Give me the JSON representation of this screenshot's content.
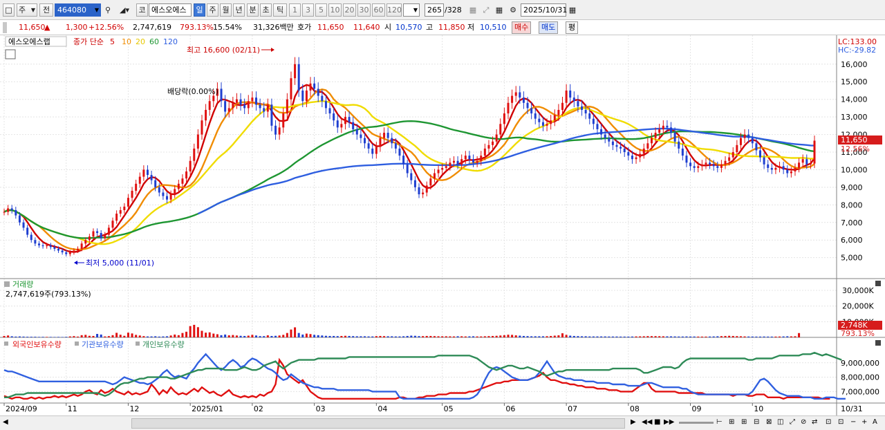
{
  "toolbar": {
    "period_select": "주",
    "mode_select": "전",
    "stock_code": "464080",
    "market_button": "코",
    "stock_name": "에스오에스",
    "period_tabs": [
      "일",
      "주",
      "월",
      "년",
      "분",
      "초",
      "틱"
    ],
    "active_period": "일",
    "interval_buttons": [
      "1",
      "3",
      "5",
      "10",
      "20",
      "30",
      "60",
      "120"
    ],
    "count_value": "265",
    "count_total": "/328",
    "date_value": "2025/10/31"
  },
  "quote": {
    "price": "11,650",
    "arrow": "▲",
    "change": "1,300",
    "change_pct": "+12.56%",
    "volume": "2,747,619",
    "volume_ratio": "793.13%",
    "turnover": "15.54%",
    "amount": "31,326백만",
    "bid_label": "호가",
    "ask": "11,650",
    "bid": "11,640",
    "open_label": "시",
    "open": "10,570",
    "high_label": "고",
    "high": "11,850",
    "low_label": "저",
    "low": "10,510",
    "buy_button": "매수",
    "sell_button": "매도",
    "eval_button": "평"
  },
  "legend": {
    "stock_name": "에스오에스랩",
    "ma_label": "종가 단순",
    "ma_periods": [
      "5",
      "10",
      "20",
      "60",
      "120"
    ],
    "ma_colors": [
      "#d00000",
      "#f08c00",
      "#f0dc00",
      "#1e9632",
      "#2e5ee0"
    ],
    "lc": "LC:133.00",
    "hc": "HC:-29.82",
    "dividend": "배당락(0.00%)",
    "max_label": "최고 16,600 (02/11)",
    "min_label": "최저 5,000 (11/01)",
    "last_price": "11,650",
    "last_pct": "12.56%"
  },
  "volume_panel": {
    "title": "거래량",
    "value": "2,747,619주(793.13%)",
    "last_value": "2,748K",
    "last_pct": "793.13%"
  },
  "holding_panel": {
    "series": [
      "외국인보유수량",
      "기관보유수량",
      "개인보유수량"
    ],
    "colors": [
      "#e01010",
      "#3060e0",
      "#2e8b57"
    ]
  },
  "x_axis": [
    "2024/09",
    "11",
    "12",
    "2025/01",
    "02",
    "03",
    "04",
    "05",
    "06",
    "07",
    "08",
    "09",
    "10",
    "10/31"
  ],
  "chart_data": [
    {
      "type": "candlestick",
      "title": "에스오에스랩",
      "y_ticks": [
        5000,
        6000,
        7000,
        8000,
        9000,
        10000,
        11000,
        12000,
        13000,
        14000,
        15000,
        16000
      ],
      "ylim": [
        4200,
        16700
      ],
      "closes": [
        7600,
        7800,
        7700,
        7400,
        7000,
        6700,
        6300,
        6000,
        5800,
        5700,
        5650,
        5700,
        5600,
        5500,
        5400,
        5300,
        5200,
        5300,
        5400,
        5500,
        5800,
        6000,
        6200,
        6500,
        6400,
        6100,
        6300,
        6700,
        7100,
        7500,
        7700,
        7900,
        8400,
        8800,
        9200,
        9600,
        10000,
        9700,
        9400,
        9000,
        8700,
        8500,
        8300,
        8600,
        8900,
        9200,
        9500,
        9900,
        10500,
        11200,
        12000,
        12800,
        13400,
        13900,
        14200,
        14600,
        13900,
        13300,
        13500,
        13800,
        14000,
        13700,
        13500,
        13900,
        14100,
        13700,
        13500,
        13300,
        13700,
        12500,
        12000,
        12400,
        13200,
        14000,
        15200,
        16000,
        14500,
        13900,
        14500,
        14900,
        14600,
        14200,
        13900,
        13500,
        13200,
        12800,
        12400,
        12600,
        13000,
        12700,
        12300,
        12000,
        11800,
        11500,
        11200,
        10900,
        11300,
        11800,
        12100,
        11800,
        11500,
        11200,
        10800,
        10300,
        9800,
        9400,
        9000,
        8600,
        8700,
        9100,
        9500,
        9800,
        10000,
        10100,
        10200,
        10400,
        10500,
        10300,
        10600,
        10800,
        10600,
        10400,
        10500,
        10800,
        11200,
        11400,
        11600,
        12000,
        12600,
        13200,
        13800,
        14200,
        14400,
        14100,
        13800,
        13500,
        13200,
        12900,
        12700,
        12500,
        12600,
        12800,
        13100,
        13400,
        13800,
        14500,
        14100,
        13900,
        13600,
        13400,
        13200,
        12900,
        12600,
        12300,
        12000,
        11800,
        11600,
        11400,
        11300,
        11200,
        11000,
        10800,
        10600,
        10700,
        10900,
        11200,
        11500,
        11800,
        12100,
        12300,
        12500,
        12400,
        12100,
        11600,
        11200,
        10800,
        10400,
        10200,
        10100,
        10200,
        10300,
        10400,
        10300,
        10200,
        10100,
        10300,
        10500,
        10700,
        11000,
        11400,
        11800,
        12000,
        11800,
        11500,
        11100,
        10700,
        10300,
        10100,
        10000,
        10100,
        10200,
        10000,
        9800,
        9900,
        10100,
        10400,
        10600,
        10300,
        10350,
        11650
      ],
      "ma_periods": [
        5,
        10,
        20,
        60,
        120
      ]
    },
    {
      "type": "bar",
      "title": "거래량",
      "y_ticks": [
        "30,000K",
        "20,000K",
        "10,000K"
      ],
      "ylim": [
        0,
        34000
      ],
      "values": [
        900,
        1200,
        700,
        500,
        600,
        500,
        400,
        400,
        400,
        300,
        350,
        300,
        300,
        250,
        300,
        250,
        350,
        600,
        800,
        500,
        1400,
        1600,
        1000,
        900,
        2200,
        1800,
        600,
        800,
        1400,
        2900,
        1700,
        1000,
        3000,
        2500,
        1600,
        1200,
        800,
        600,
        600,
        700,
        500,
        600,
        700,
        1200,
        1800,
        1400,
        2800,
        3600,
        7200,
        8000,
        6500,
        4200,
        3000,
        3200,
        2400,
        2000,
        1400,
        1800,
        1300,
        1500,
        1200,
        1000,
        900,
        1100,
        1600,
        1200,
        800,
        800,
        1300,
        900,
        1000,
        1200,
        1600,
        2800,
        5000,
        6400,
        2800,
        1800,
        2400,
        2100,
        1600,
        1400,
        1200,
        1000,
        900,
        900,
        800,
        900,
        1000,
        900,
        800,
        700,
        700,
        700,
        600,
        600,
        800,
        900,
        800,
        700,
        700,
        600,
        600,
        700,
        900,
        1100,
        1000,
        800,
        800,
        900,
        900,
        800,
        700,
        700,
        700,
        650,
        600,
        700,
        700,
        600,
        650,
        700,
        600,
        600,
        700,
        800,
        900,
        1000,
        1200,
        1400,
        1700,
        1600,
        1300,
        1100,
        900,
        800,
        700,
        700,
        700,
        700,
        750,
        900,
        1100,
        1300,
        2600,
        1600,
        1100,
        900,
        800,
        700,
        700,
        600,
        600,
        600,
        600,
        600,
        550,
        550,
        550,
        500,
        500,
        500,
        550,
        600,
        650,
        700,
        800,
        800,
        800,
        750,
        700,
        650,
        650,
        600,
        550,
        550,
        600,
        550,
        550,
        500,
        500,
        500,
        550,
        600,
        700,
        800,
        900,
        1000,
        900,
        800,
        700,
        600,
        550,
        550,
        500,
        500,
        550,
        500,
        500,
        500,
        550,
        600,
        700,
        650,
        700,
        2748
      ]
    },
    {
      "type": "line",
      "title": "보유수량",
      "y_ticks": [
        "9,000,000",
        "8,000,000",
        "7,000,000"
      ],
      "ylim": [
        6300000,
        9900000
      ],
      "series": [
        {
          "name": "외국인보유수량",
          "values": [
            6.7,
            6.6,
            6.5,
            6.6,
            6.6,
            6.5,
            6.5,
            6.6,
            6.5,
            6.6,
            6.5,
            6.6,
            6.6,
            6.7,
            6.6,
            6.7,
            6.6,
            6.7,
            6.8,
            6.7,
            6.8,
            7.0,
            7.1,
            6.9,
            6.8,
            7.1,
            6.9,
            7.0,
            7.2,
            7.0,
            6.9,
            6.8,
            7.0,
            6.8,
            6.9,
            6.8,
            6.9,
            7.0,
            7.5,
            7.2,
            6.8,
            7.1,
            6.9,
            7.3,
            7.0,
            6.8,
            6.9,
            6.8,
            7.0,
            7.2,
            7.0,
            7.3,
            7.1,
            6.9,
            7.0,
            6.8,
            6.7,
            6.9,
            7.1,
            6.8,
            6.7,
            6.6,
            6.7,
            6.6,
            6.7,
            6.6,
            6.8,
            6.7,
            6.9,
            7.0,
            7.5,
            9.2,
            8.8,
            8.2,
            8.0,
            7.8,
            7.6,
            7.8,
            7.4,
            7.0,
            6.8,
            6.6,
            6.5,
            6.5,
            6.5,
            6.5,
            6.5,
            6.5,
            6.5,
            6.5,
            6.5,
            6.5,
            6.5,
            6.5,
            6.5,
            6.5,
            6.5,
            6.5,
            6.5,
            6.5,
            6.5,
            6.5,
            6.6,
            6.6,
            6.5,
            6.5,
            6.5,
            6.6,
            6.6,
            6.7,
            6.7,
            6.7,
            6.8,
            6.8,
            6.8,
            6.9,
            6.9,
            6.9,
            6.9,
            6.9,
            7.0,
            7.0,
            7.1,
            7.2,
            7.3,
            7.4,
            7.5,
            7.6,
            7.6,
            7.7,
            7.7,
            7.8,
            7.8,
            7.8,
            7.8,
            7.8,
            7.9,
            8.0,
            8.1,
            8.3,
            8.0,
            7.8,
            7.8,
            7.7,
            7.6,
            7.6,
            7.5,
            7.5,
            7.4,
            7.4,
            7.3,
            7.3,
            7.3,
            7.2,
            7.2,
            7.2,
            7.1,
            7.1,
            7.1,
            7.0,
            7.0,
            7.0,
            7.0,
            7.2,
            7.4,
            7.6,
            7.6,
            7.2,
            7.0,
            7.0,
            7.0,
            7.0,
            7.0,
            7.0,
            6.9,
            6.9,
            6.9,
            6.9,
            6.9,
            6.9,
            6.9,
            6.8,
            6.8,
            6.8,
            6.8,
            6.8,
            6.8,
            6.8,
            6.7,
            6.8,
            6.8,
            6.8,
            6.7,
            6.7,
            6.8,
            6.8,
            6.8,
            6.6,
            6.6,
            6.6,
            6.6,
            6.5,
            6.6,
            6.6,
            6.6,
            6.6,
            6.6,
            6.6,
            6.6,
            6.6,
            6.6,
            6.5,
            6.5,
            6.5
          ]
        },
        {
          "name": "기관보유수량",
          "values": [
            8.5,
            8.4,
            8.4,
            8.3,
            8.2,
            8.1,
            8.0,
            7.9,
            7.8,
            7.7,
            7.7,
            7.7,
            7.7,
            7.7,
            7.7,
            7.7,
            7.7,
            7.7,
            7.7,
            7.7,
            7.7,
            7.7,
            7.7,
            7.7,
            7.7,
            7.7,
            7.7,
            7.6,
            7.5,
            7.6,
            7.8,
            8.0,
            7.9,
            7.8,
            7.7,
            7.6,
            7.6,
            7.5,
            7.6,
            7.8,
            8.0,
            8.3,
            8.5,
            8.2,
            8.0,
            8.1,
            8.0,
            7.9,
            8.3,
            8.6,
            9.0,
            9.3,
            9.6,
            9.3,
            9.0,
            8.7,
            8.5,
            8.7,
            9.0,
            9.2,
            9.0,
            8.7,
            8.8,
            9.1,
            9.3,
            9.2,
            9.0,
            8.8,
            8.6,
            8.5,
            8.3,
            8.0,
            7.8,
            7.9,
            8.2,
            8.0,
            7.8,
            7.6,
            7.5,
            7.4,
            7.3,
            7.3,
            7.2,
            7.2,
            7.2,
            7.2,
            7.1,
            7.1,
            7.1,
            7.1,
            7.1,
            7.1,
            7.1,
            7.1,
            7.1,
            7.0,
            7.0,
            7.0,
            7.0,
            7.0,
            7.0,
            7.0,
            6.6,
            6.5,
            6.5,
            6.5,
            6.5,
            6.5,
            6.5,
            6.5,
            6.5,
            6.5,
            6.5,
            6.5,
            6.5,
            6.5,
            6.5,
            6.5,
            6.5,
            6.5,
            6.5,
            6.6,
            6.8,
            7.2,
            7.8,
            8.3,
            8.6,
            8.7,
            8.6,
            8.4,
            8.2,
            8.0,
            7.9,
            7.8,
            7.8,
            7.8,
            7.9,
            8.0,
            8.3,
            8.7,
            9.1,
            8.7,
            8.3,
            8.1,
            8.0,
            7.9,
            7.9,
            7.8,
            7.8,
            7.8,
            7.7,
            7.7,
            7.7,
            7.6,
            7.6,
            7.6,
            7.6,
            7.5,
            7.5,
            7.5,
            7.5,
            7.4,
            7.4,
            7.4,
            7.4,
            7.5,
            7.6,
            7.6,
            7.5,
            7.4,
            7.3,
            7.3,
            7.3,
            7.3,
            7.3,
            7.2,
            7.2,
            7.0,
            6.9,
            6.8,
            6.8,
            6.8,
            6.8,
            6.8,
            6.8,
            6.8,
            6.8,
            6.8,
            6.8,
            6.8,
            6.8,
            6.8,
            6.8,
            7.0,
            7.4,
            7.8,
            7.9,
            7.7,
            7.4,
            7.1,
            6.9,
            6.8,
            6.7,
            6.7,
            6.7,
            6.7,
            6.6,
            6.6,
            6.6,
            6.5,
            6.5,
            6.5,
            6.6,
            6.6,
            6.6,
            6.5,
            6.5,
            6.5
          ]
        },
        {
          "name": "개인보유수량",
          "values": [
            6.6,
            6.6,
            6.7,
            6.8,
            6.8,
            6.8,
            6.9,
            6.9,
            6.9,
            6.9,
            6.9,
            6.9,
            6.9,
            6.9,
            6.9,
            6.9,
            6.9,
            6.9,
            6.9,
            6.9,
            6.9,
            6.9,
            6.9,
            6.9,
            6.9,
            6.8,
            6.7,
            6.8,
            7.0,
            7.3,
            7.5,
            7.6,
            7.6,
            7.7,
            7.8,
            7.9,
            7.9,
            8.0,
            8.0,
            8.0,
            8.0,
            8.0,
            8.0,
            7.9,
            7.9,
            8.0,
            8.1,
            8.2,
            8.3,
            8.4,
            8.5,
            8.5,
            8.6,
            8.6,
            8.6,
            8.6,
            8.6,
            8.5,
            8.5,
            8.5,
            8.5,
            8.6,
            8.7,
            8.6,
            8.5,
            8.5,
            8.6,
            8.8,
            8.9,
            9.0,
            9.1,
            8.8,
            8.6,
            8.8,
            9.0,
            9.1,
            9.2,
            9.2,
            9.2,
            9.2,
            9.2,
            9.3,
            9.3,
            9.3,
            9.3,
            9.3,
            9.3,
            9.3,
            9.3,
            9.4,
            9.4,
            9.4,
            9.4,
            9.4,
            9.4,
            9.4,
            9.4,
            9.4,
            9.4,
            9.4,
            9.4,
            9.4,
            9.4,
            9.4,
            9.4,
            9.4,
            9.4,
            9.4,
            9.4,
            9.4,
            9.4,
            9.4,
            9.5,
            9.5,
            9.5,
            9.5,
            9.5,
            9.5,
            9.5,
            9.5,
            9.5,
            9.4,
            9.3,
            9.1,
            8.9,
            8.7,
            8.6,
            8.5,
            8.6,
            8.7,
            8.8,
            8.8,
            8.7,
            8.6,
            8.6,
            8.7,
            8.6,
            8.5,
            8.4,
            8.2,
            8.1,
            8.2,
            8.3,
            8.4,
            8.4,
            8.5,
            8.5,
            8.5,
            8.5,
            8.5,
            8.5,
            8.5,
            8.5,
            8.5,
            8.5,
            8.5,
            8.5,
            8.6,
            8.6,
            8.6,
            8.6,
            8.6,
            8.6,
            8.6,
            8.5,
            8.3,
            8.3,
            8.4,
            8.5,
            8.6,
            8.7,
            8.7,
            8.7,
            8.6,
            8.7,
            9.0,
            9.2,
            9.3,
            9.3,
            9.3,
            9.3,
            9.3,
            9.3,
            9.3,
            9.3,
            9.3,
            9.3,
            9.3,
            9.3,
            9.3,
            9.3,
            9.3,
            9.2,
            9.2,
            9.3,
            9.3,
            9.3,
            9.3,
            9.3,
            9.4,
            9.5,
            9.5,
            9.5,
            9.5,
            9.5,
            9.5,
            9.6,
            9.6,
            9.6,
            9.7,
            9.6,
            9.5,
            9.6,
            9.5,
            9.4,
            9.3,
            9.2
          ]
        }
      ]
    }
  ]
}
